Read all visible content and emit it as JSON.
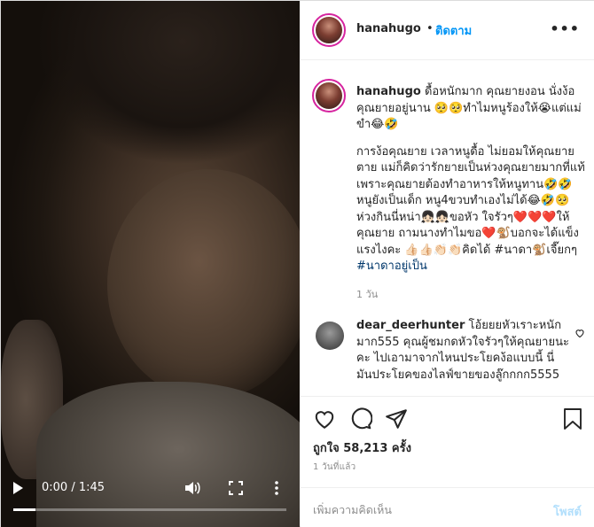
{
  "video": {
    "time": "0:00 / 1:45",
    "progress": 0.08
  },
  "header": {
    "username": "hanahugo",
    "separator": "•",
    "follow_label": "ติดตาม",
    "options_label": "•••"
  },
  "caption": {
    "username": "hanahugo",
    "paragraph1": "ดื้อหนักมาก คุณยายงอน นั่งง้อคุณยายอยู่นาน 🥺🥺ทำไมหนูร้องให้😭แต่แม่ขำ😂🤣",
    "paragraph2": "การง้อคุณยาย เวลาหนูดื้อ ไม่ยอมให้คุณยายตาย แม่ก็คิดว่ารักยายเป็นห่วงคุณยายมากที่แท้ เพราะคุณยายต้องทำอาหารให้หนูทาน🤣🤣หนูยังเป็นเด็ก หนู4ขวบทำเองไม่ได้😂🤣🥺ห่วงกินนี่หน่า👧🏻👧🏻ขอหัว ใจรัวๆ❤️❤️❤️ให้คุณยาย ถามนางทำไมขอ❤️🐒บอกจะได้แข็งแรงไงคะ 👍🏻👍🏻👏🏻👏🏻คิดได้ #นาดา🐒เจี๊ยกๆ",
    "tag": "#นาดาอยู่เป็น",
    "age": "1 วัน"
  },
  "comment": {
    "username": "dear_deerhunter",
    "text": "โอ้ยยยหัวเราะหนักมาก555 คุณผู้ชมกดหัวใจรัวๆให้คุณยายนะคะ ไปเอามาจากไหนประโยคง้อแบบนี้ นี่มันประโยคของไลฟ์ขายของลู๊กกกก5555"
  },
  "actions": {
    "likes": "ถูกใจ 58,213 ครั้ง",
    "age": "1 วันที่แล้ว"
  },
  "add_comment": {
    "placeholder": "เพิ่มความคิดเห็น",
    "post_label": "โพสต์"
  },
  "colors": {
    "follow": "#0095f6",
    "post_disabled": "#b2dffc",
    "muted": "#8e8e8e"
  }
}
